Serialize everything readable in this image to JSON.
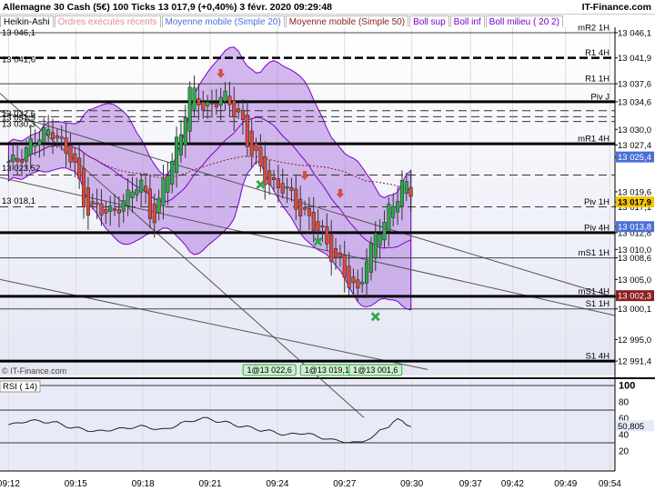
{
  "header": {
    "title": "Allemagne 30 Cash (5€)   100 Ticks   13 017,9 (+0,40%)   3 févr. 2020 09:29:48",
    "brand": "IT-Finance.com"
  },
  "indicators": [
    {
      "label": "Heikin-Ashi",
      "color": "#000000"
    },
    {
      "label": "Ordres exécutés récents",
      "color": "#e58a8a"
    },
    {
      "label": "Moyenne mobile (Simple 20)",
      "color": "#4a6fd8"
    },
    {
      "label": "Moyenne mobile (Simple 50)",
      "color": "#8b2020"
    },
    {
      "label": "Boll sup",
      "color": "#7a00c8"
    },
    {
      "label": "Boll inf",
      "color": "#7a00c8"
    },
    {
      "label": "Boll milieu ( 20 2)",
      "color": "#7a00c8"
    }
  ],
  "watermark": "© IT-Finance.com",
  "colors": {
    "up": "#2ea84a",
    "down": "#d84b3c",
    "band": "#b07ee0",
    "grid": "#dcdcdc"
  },
  "chart_data": {
    "type": "candlestick",
    "ylim": [
      12989,
      13047
    ],
    "price_ticks": [
      13046.1,
      13041.9,
      13037.6,
      13034.6,
      13030,
      13027.4,
      13025.4,
      13019.6,
      13017.9,
      13017.1,
      13013.8,
      13012.8,
      13010,
      13008.6,
      13005,
      13002.3,
      13002.1,
      13000.1,
      12995,
      12991.4
    ],
    "highlight_ticks": [
      {
        "value": 13025.4,
        "color": "#4a6fd8"
      },
      {
        "value": 13017.9,
        "color": "#f5c400",
        "bold": true
      },
      {
        "value": 13013.8,
        "color": "#4a6fd8"
      },
      {
        "value": 13002.3,
        "color": "#8b2020"
      }
    ],
    "time_labels": [
      "09:12",
      "09:15",
      "09:18",
      "09:21",
      "09:24",
      "09:27",
      "09:30",
      "09:37",
      "09:42",
      "09:49",
      "09:54"
    ],
    "time_positions": [
      0.0,
      15.2,
      30.4,
      45.6,
      60.8,
      76.0,
      91.2,
      104.5,
      114.0,
      126.0,
      136.0
    ],
    "last_bar_index": 91,
    "ohlc_anchors": [
      [
        0,
        13024
      ],
      [
        6,
        13028
      ],
      [
        10,
        13030
      ],
      [
        14,
        13025
      ],
      [
        18,
        13017
      ],
      [
        22,
        13016
      ],
      [
        26,
        13018
      ],
      [
        30,
        13021
      ],
      [
        33,
        13015
      ],
      [
        36,
        13023
      ],
      [
        39,
        13030
      ],
      [
        41,
        13036
      ],
      [
        44,
        13034
      ],
      [
        48,
        13035
      ],
      [
        52,
        13033
      ],
      [
        55,
        13026
      ],
      [
        58,
        13022
      ],
      [
        62,
        13020
      ],
      [
        66,
        13017
      ],
      [
        70,
        13013
      ],
      [
        74,
        13009
      ],
      [
        77,
        13004
      ],
      [
        79,
        13003
      ],
      [
        81,
        13009
      ],
      [
        84,
        13013
      ],
      [
        87,
        13018
      ],
      [
        89,
        13021
      ],
      [
        91,
        13019
      ]
    ],
    "levels": [
      {
        "label": "mR2 1H",
        "value": 13046.1,
        "style": "thin"
      },
      {
        "label": "R1 4H",
        "value": 13041.9,
        "style": "thick-dash"
      },
      {
        "label": "R1 1H",
        "value": 13037.6,
        "style": "thin"
      },
      {
        "label": "Piv J",
        "value": 13034.6,
        "style": "thick"
      },
      {
        "label": "",
        "value": 13033.1,
        "style": "dash"
      },
      {
        "label": "",
        "value": 13032.1,
        "style": "dash"
      },
      {
        "label": "",
        "value": 13031.3,
        "style": "dash"
      },
      {
        "label": "mR1 4H",
        "value": 13027.6,
        "style": "thick"
      },
      {
        "label": "",
        "value": 13022.4,
        "style": "dash"
      },
      {
        "label": "Piv 1H",
        "value": 13017.1,
        "style": "dash"
      },
      {
        "label": "Piv 4H",
        "value": 13012.8,
        "style": "thick"
      },
      {
        "label": "mS1 1H",
        "value": 13008.6,
        "style": "thin"
      },
      {
        "label": "mS1 4H",
        "value": 13002.2,
        "style": "thick"
      },
      {
        "label": "S1 1H",
        "value": 13000.1,
        "style": "thin"
      },
      {
        "label": "S1 4H",
        "value": 12991.4,
        "style": "thick"
      }
    ],
    "left_labels": [
      {
        "text": "13 046,1",
        "value": 13046.1
      },
      {
        "text": "13 041,6",
        "value": 13041.6
      },
      {
        "text": "13 032,6",
        "value": 13032.6
      },
      {
        "text": "13 031,9",
        "value": 13031.9
      },
      {
        "text": "13 030,3",
        "value": 13030.9
      },
      {
        "text": "13 023,52",
        "value": 13023.5
      },
      {
        "text": "13 018,1",
        "value": 13018.1
      }
    ],
    "order_labels": [
      {
        "text": "1@13 022,6",
        "bar": 59
      },
      {
        "text": "1@13 019,1",
        "bar": 72
      },
      {
        "text": "1@13 001,6",
        "bar": 83
      }
    ],
    "sell_arrows": [
      [
        48,
        13039
      ],
      [
        67,
        13022
      ],
      [
        75,
        13019
      ]
    ],
    "buy_markers": [
      [
        57,
        13020.8
      ],
      [
        70,
        13011.3
      ],
      [
        83,
        12998.8
      ]
    ],
    "rsi": {
      "label": "RSI ( 14)",
      "ylim": [
        0,
        100
      ],
      "ticks": [
        100,
        80,
        60,
        40,
        20
      ],
      "levels": [
        100,
        70,
        30
      ],
      "current": 50.805,
      "current_label": "50,805",
      "anchors": [
        [
          0,
          52
        ],
        [
          5,
          57
        ],
        [
          10,
          55
        ],
        [
          15,
          48
        ],
        [
          20,
          44
        ],
        [
          25,
          47
        ],
        [
          30,
          50
        ],
        [
          35,
          46
        ],
        [
          40,
          55
        ],
        [
          44,
          60
        ],
        [
          48,
          56
        ],
        [
          53,
          50
        ],
        [
          58,
          45
        ],
        [
          63,
          40
        ],
        [
          67,
          42
        ],
        [
          71,
          36
        ],
        [
          75,
          32
        ],
        [
          79,
          30
        ],
        [
          82,
          36
        ],
        [
          85,
          48
        ],
        [
          88,
          58
        ],
        [
          91,
          51
        ]
      ]
    }
  }
}
